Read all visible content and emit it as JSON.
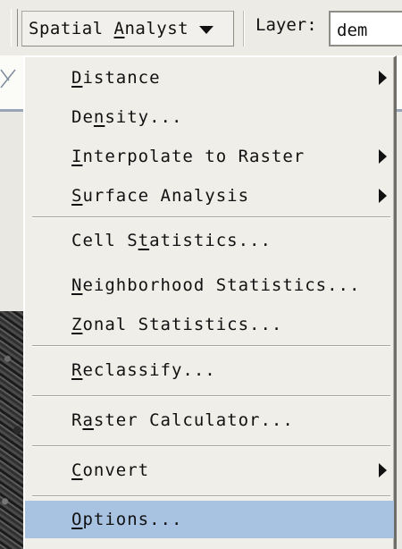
{
  "toolbar": {
    "spatial_analyst": {
      "pre": "Spatial ",
      "key": "A",
      "post": "nalyst"
    },
    "layer_label": "Layer:",
    "layer_value": "dem"
  },
  "menu": {
    "items": [
      {
        "id": "distance",
        "pre": "",
        "key": "D",
        "post": "istance",
        "submenu": true
      },
      {
        "id": "density",
        "pre": "De",
        "key": "n",
        "post": "sity...",
        "submenu": false
      },
      {
        "id": "interpolate",
        "pre": "",
        "key": "I",
        "post": "nterpolate to Raster",
        "submenu": true
      },
      {
        "id": "surface",
        "pre": "",
        "key": "S",
        "post": "urface Analysis",
        "submenu": true
      },
      {
        "id": "cell-stats",
        "pre": "Cell S",
        "key": "t",
        "post": "atistics...",
        "submenu": false
      },
      {
        "id": "neighborhood",
        "pre": "",
        "key": "N",
        "post": "eighborhood Statistics...",
        "submenu": false
      },
      {
        "id": "zonal",
        "pre": "",
        "key": "Z",
        "post": "onal Statistics...",
        "submenu": false
      },
      {
        "id": "reclassify",
        "pre": "",
        "key": "R",
        "post": "eclassify...",
        "submenu": false
      },
      {
        "id": "raster-calc",
        "pre": "R",
        "key": "a",
        "post": "ster Calculator...",
        "submenu": false
      },
      {
        "id": "convert",
        "pre": "",
        "key": "C",
        "post": "onvert",
        "submenu": true
      },
      {
        "id": "options",
        "pre": "",
        "key": "O",
        "post": "ptions...",
        "submenu": false,
        "selected": true
      }
    ]
  },
  "colors": {
    "menu_bg": "#efeee9",
    "selection": "#a8c2e2",
    "text": "#111111"
  },
  "icons": [
    "chevron-down-icon",
    "submenu-arrow-icon",
    "toolbar-grip-icon",
    "map-tool-icon"
  ]
}
